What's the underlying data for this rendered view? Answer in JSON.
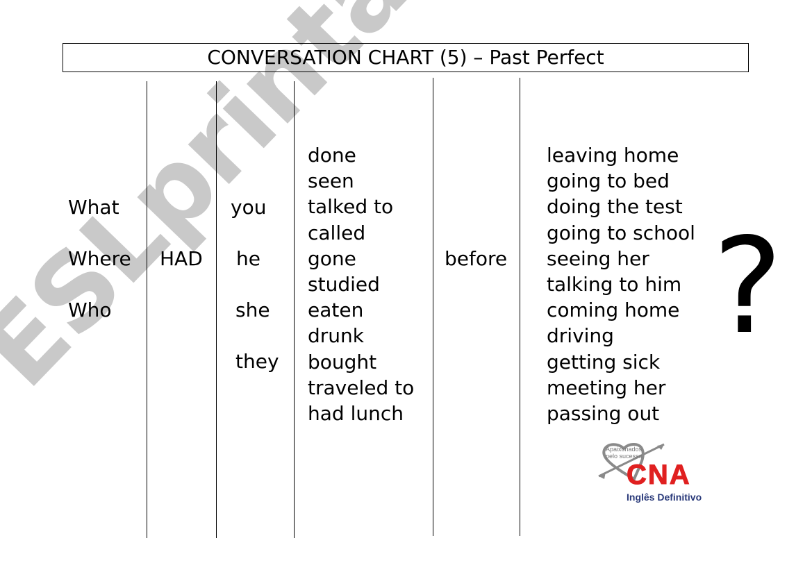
{
  "title": "CONVERSATION CHART (5) – Past Perfect",
  "watermark": "ESLprintables.com",
  "columns": {
    "question_words": [
      "What",
      "Where",
      "Who"
    ],
    "auxiliary": "HAD",
    "subjects": [
      "you",
      "he",
      "she",
      "they"
    ],
    "past_participles": [
      "done",
      "seen",
      "talked to",
      "called",
      "gone",
      "studied",
      "eaten",
      "drunk",
      "bought",
      "traveled to",
      "had lunch"
    ],
    "connector": "before",
    "gerund_phrases": [
      "leaving home",
      "going to bed",
      "doing the test",
      "going to school",
      "seeing her",
      "talking to him",
      "coming home",
      "driving",
      "getting sick",
      "meeting her",
      "passing out"
    ]
  },
  "question_mark": "?",
  "logo": {
    "tagline_line1": "Apaixonados",
    "tagline_line2": "pelo sucesso.",
    "brand": "CNA",
    "subtitle": "Inglês Definitivo",
    "brand_color": "#e02020",
    "subtitle_color": "#2a3a7a"
  }
}
